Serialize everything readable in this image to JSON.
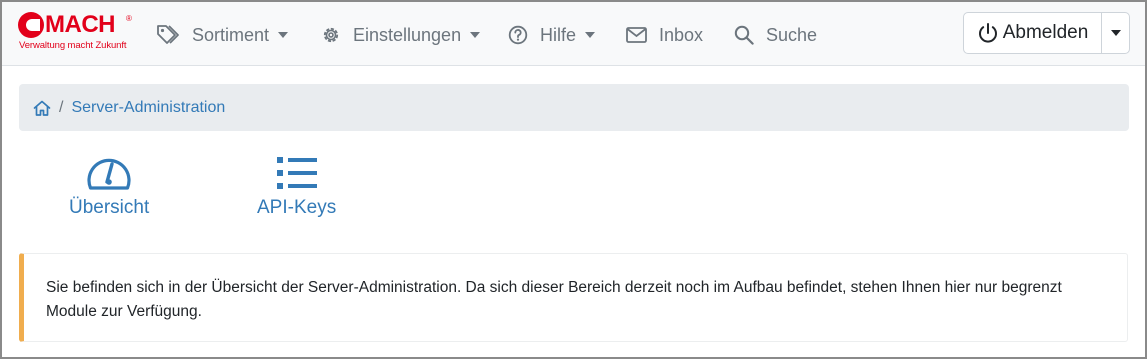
{
  "logo": {
    "brand": "MACH",
    "registered": "®",
    "tagline": "Verwaltung macht Zukunft"
  },
  "nav": {
    "sortiment": "Sortiment",
    "einstellungen": "Einstellungen",
    "hilfe": "Hilfe",
    "inbox": "Inbox",
    "suche": "Suche"
  },
  "logout": {
    "label": "Abmelden"
  },
  "breadcrumb": {
    "current": "Server-Administration"
  },
  "tiles": [
    {
      "label": "Übersicht",
      "icon": "gauge-icon"
    },
    {
      "label": "API-Keys",
      "icon": "list-icon"
    }
  ],
  "alert": {
    "text": "Sie befinden sich in der Übersicht der Server-Administration. Da sich dieser Bereich derzeit noch im Aufbau befindet, stehen Ihnen hier nur begrenzt Module zur Verfügung."
  },
  "colors": {
    "brand": "#e2001a",
    "link": "#337ab7",
    "warning": "#f0ad4e",
    "navText": "#6c757d"
  }
}
